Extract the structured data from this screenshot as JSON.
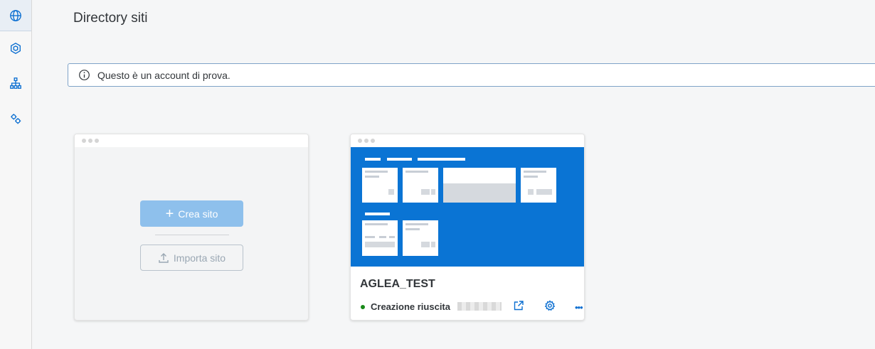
{
  "page": {
    "title": "Directory siti"
  },
  "sidebar": {
    "items": [
      {
        "icon": "globe-icon",
        "active": true
      },
      {
        "icon": "cube-icon",
        "active": false
      },
      {
        "icon": "sitemap-icon",
        "active": false
      },
      {
        "icon": "gears-icon",
        "active": false
      }
    ]
  },
  "banner": {
    "icon": "info-icon",
    "text": "Questo è un account di prova."
  },
  "create_card": {
    "create_label": "Crea sito",
    "import_label": "Importa sito"
  },
  "site_card": {
    "name": "AGLEA_TEST",
    "status": "Creazione riuscita",
    "status_color": "#188918",
    "actions": [
      "open-external-icon",
      "settings-icon",
      "more-icon"
    ]
  },
  "colors": {
    "accent": "#0a6ed1",
    "preview_blue": "#0a74d4",
    "create_button": "#8ec0ec"
  }
}
